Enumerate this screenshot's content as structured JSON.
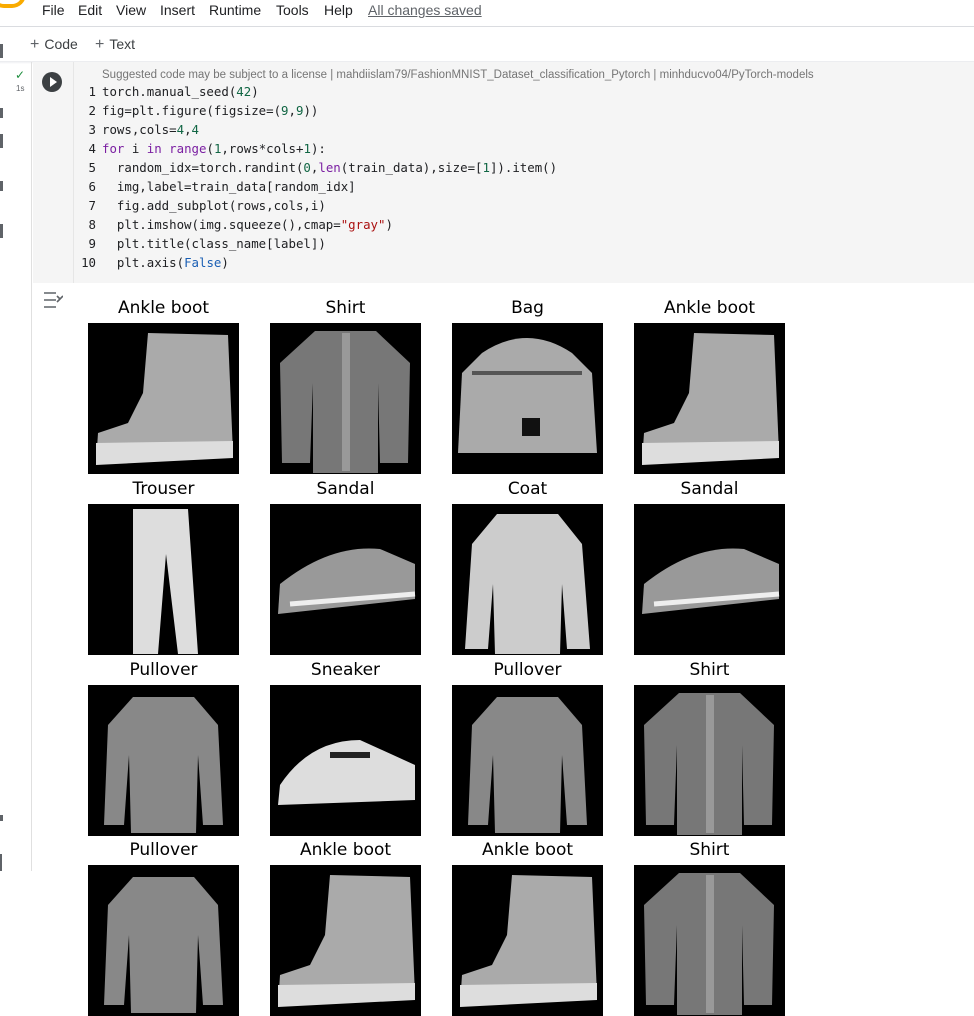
{
  "menu": {
    "items": [
      "File",
      "Edit",
      "View",
      "Insert",
      "Runtime",
      "Tools",
      "Help"
    ],
    "status": "All changes saved"
  },
  "toolbar": {
    "code_label": "Code",
    "text_label": "Text"
  },
  "cell": {
    "exec_time": "1s",
    "license_notice": "Suggested code may be subject to a license | mahdiislam79/FashionMNIST_Dataset_classification_Pytorch | minhducvo04/PyTorch-models",
    "line_numbers": [
      "1",
      "2",
      "3",
      "4",
      "5",
      "6",
      "7",
      "8",
      "9",
      "10"
    ],
    "code": [
      "torch.manual_seed(42)",
      "fig=plt.figure(figsize=(9,9))",
      "rows,cols=4,4",
      "for i in range(1,rows*cols+1):",
      "  random_idx=torch.randint(0,len(train_data),size=[1]).item()",
      "  img,label=train_data[random_idx]",
      "  fig.add_subplot(rows,cols,i)",
      "  plt.imshow(img.squeeze(),cmap=\"gray\")",
      "  plt.title(class_name[label])",
      "  plt.axis(False)"
    ]
  },
  "output": {
    "titles": [
      "Ankle boot",
      "Shirt",
      "Bag",
      "Ankle boot",
      "Trouser",
      "Sandal",
      "Coat",
      "Sandal",
      "Pullover",
      "Sneaker",
      "Pullover",
      "Shirt",
      "Pullover",
      "Ankle boot",
      "Ankle boot",
      "Shirt"
    ]
  },
  "colors": {
    "accent": "#f9ab00",
    "success": "#1e8e3e",
    "cell_bg": "#f5f5f5"
  },
  "icons": [
    "run-icon",
    "check-icon",
    "output-toggle-icon",
    "plus-icon"
  ]
}
